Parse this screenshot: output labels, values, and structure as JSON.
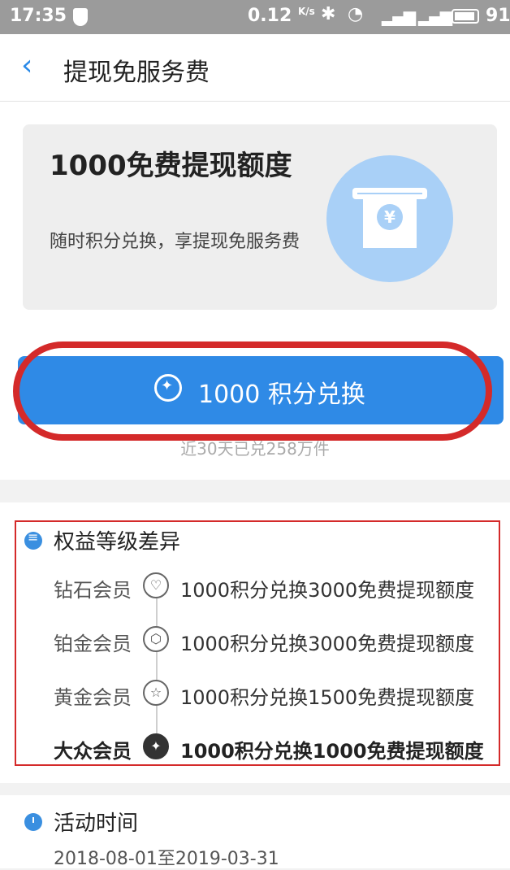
{
  "status_bar": {
    "time": "17:35",
    "speed": "0.12",
    "speed_unit": "K/s",
    "battery": "91"
  },
  "nav": {
    "back_icon": "chevron-left-icon",
    "title": "提现免服务费"
  },
  "hero": {
    "title": "1000免费提现额度",
    "subtitle": "随时积分兑换，享提现免服务费",
    "icon": "atm-withdraw-icon",
    "icon_color": "#a9d0f7"
  },
  "exchange_button": {
    "label": "1000 积分兑换",
    "icon": "diamond-star-icon",
    "color": "#2f8ae6"
  },
  "sales_note": "近30天已兑258万件",
  "tiers": {
    "title": "权益等级差异",
    "rows": [
      {
        "name": "钻石会员",
        "badge": "♡",
        "desc": "1000积分兑换3000免费提现额度",
        "active": false
      },
      {
        "name": "铂金会员",
        "badge": "⬡",
        "desc": "1000积分兑换3000免费提现额度",
        "active": false
      },
      {
        "name": "黄金会员",
        "badge": "☆",
        "desc": "1000积分兑换1500免费提现额度",
        "active": false
      },
      {
        "name": "大众会员",
        "badge": "✦",
        "desc": "1000积分兑换1000免费提现额度",
        "active": true
      }
    ]
  },
  "activity": {
    "title": "活动时间",
    "range": "2018-08-01至2019-03-31"
  },
  "colors": {
    "accent": "#2f8ae6",
    "annotation_red": "#d42a2a"
  }
}
